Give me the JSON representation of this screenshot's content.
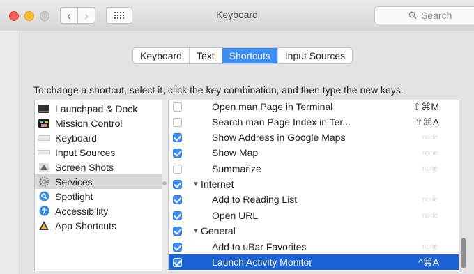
{
  "window": {
    "title": "Keyboard"
  },
  "search": {
    "placeholder": "Search"
  },
  "tabs": [
    {
      "label": "Keyboard",
      "active": false
    },
    {
      "label": "Text",
      "active": false
    },
    {
      "label": "Shortcuts",
      "active": true
    },
    {
      "label": "Input Sources",
      "active": false
    }
  ],
  "instruction": "To change a shortcut, select it, click the key combination, and then type the new keys.",
  "categories": [
    {
      "label": "Launchpad & Dock",
      "icon": "launchpad-icon"
    },
    {
      "label": "Mission Control",
      "icon": "mission-control-icon"
    },
    {
      "label": "Keyboard",
      "icon": "keyboard-icon"
    },
    {
      "label": "Input Sources",
      "icon": "input-sources-icon"
    },
    {
      "label": "Screen Shots",
      "icon": "screenshot-icon"
    },
    {
      "label": "Services",
      "icon": "gear-icon",
      "selected": true
    },
    {
      "label": "Spotlight",
      "icon": "spotlight-icon"
    },
    {
      "label": "Accessibility",
      "icon": "accessibility-icon"
    },
    {
      "label": "App Shortcuts",
      "icon": "app-shortcuts-icon"
    }
  ],
  "shortcuts": [
    {
      "label": "Open man Page in Terminal",
      "checked": false,
      "key": "⇧⌘M"
    },
    {
      "label": "Search man Page Index in Ter...",
      "checked": false,
      "key": "⇧⌘A"
    },
    {
      "label": "Show Address in Google Maps",
      "checked": true,
      "key": "none"
    },
    {
      "label": "Show Map",
      "checked": true,
      "key": "none"
    },
    {
      "label": "Summarize",
      "checked": false,
      "key": "none"
    },
    {
      "label": "Internet",
      "checked": true,
      "group": true,
      "key": ""
    },
    {
      "label": "Add to Reading List",
      "checked": true,
      "key": "none"
    },
    {
      "label": "Open URL",
      "checked": true,
      "key": "none"
    },
    {
      "label": "General",
      "checked": true,
      "group": true,
      "key": ""
    },
    {
      "label": "Add to uBar Favorites",
      "checked": true,
      "key": "none"
    },
    {
      "label": "Launch Activity Monitor",
      "checked": true,
      "key": "^⌘A",
      "selected": true
    }
  ],
  "colors": {
    "accent": "#3d8ef8",
    "selection": "#1a62d6"
  }
}
